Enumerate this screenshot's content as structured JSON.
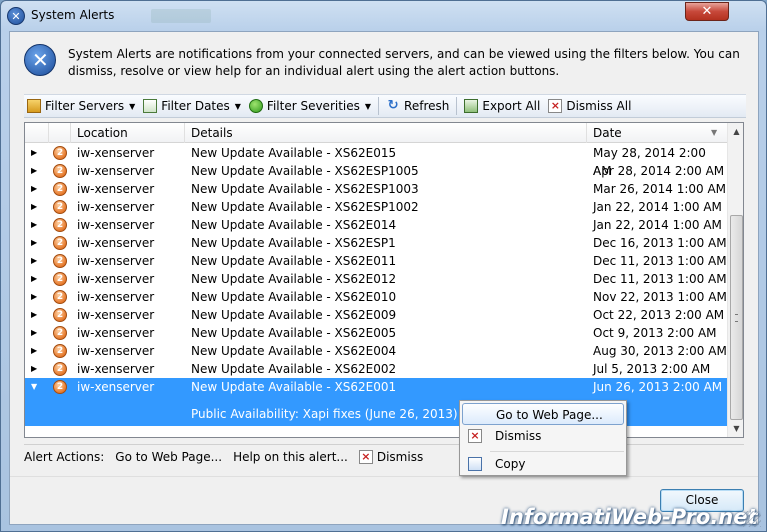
{
  "window": {
    "title": "System Alerts",
    "close_glyph": "✕"
  },
  "info": {
    "text": "System Alerts are notifications from your connected servers, and can be viewed using the filters below. You can dismiss, resolve or view help for an individual alert using the alert action buttons.",
    "icon": "xenserver-icon"
  },
  "toolbar": {
    "filter_servers": "Filter Servers",
    "filter_dates": "Filter Dates",
    "filter_severities": "Filter Severities",
    "refresh": "Refresh",
    "export_all": "Export All",
    "dismiss_all": "Dismiss All"
  },
  "grid": {
    "columns": {
      "location": "Location",
      "details": "Details",
      "date": "Date"
    },
    "rows": [
      {
        "location": "iw-xenserver",
        "details": "New Update Available - XS62E015",
        "date": "May 28, 2014 2:00 AM"
      },
      {
        "location": "iw-xenserver",
        "details": "New Update Available - XS62ESP1005",
        "date": "Apr 28, 2014 2:00 AM"
      },
      {
        "location": "iw-xenserver",
        "details": "New Update Available - XS62ESP1003",
        "date": "Mar 26, 2014 1:00 AM"
      },
      {
        "location": "iw-xenserver",
        "details": "New Update Available - XS62ESP1002",
        "date": "Jan 22, 2014 1:00 AM"
      },
      {
        "location": "iw-xenserver",
        "details": "New Update Available - XS62E014",
        "date": "Jan 22, 2014 1:00 AM"
      },
      {
        "location": "iw-xenserver",
        "details": "New Update Available - XS62ESP1",
        "date": "Dec 16, 2013 1:00 AM"
      },
      {
        "location": "iw-xenserver",
        "details": "New Update Available - XS62E011",
        "date": "Dec 11, 2013 1:00 AM"
      },
      {
        "location": "iw-xenserver",
        "details": "New Update Available - XS62E012",
        "date": "Dec 11, 2013 1:00 AM"
      },
      {
        "location": "iw-xenserver",
        "details": "New Update Available - XS62E010",
        "date": "Nov 22, 2013 1:00 AM"
      },
      {
        "location": "iw-xenserver",
        "details": "New Update Available - XS62E009",
        "date": "Oct 22, 2013 2:00 AM"
      },
      {
        "location": "iw-xenserver",
        "details": "New Update Available - XS62E005",
        "date": "Oct 9, 2013 2:00 AM"
      },
      {
        "location": "iw-xenserver",
        "details": "New Update Available - XS62E004",
        "date": "Aug 30, 2013 2:00 AM"
      },
      {
        "location": "iw-xenserver",
        "details": "New Update Available - XS62E002",
        "date": "Jul 5, 2013 2:00 AM"
      }
    ],
    "selected": {
      "location": "iw-xenserver",
      "details": "New Update Available - XS62E001",
      "date": "Jun 26, 2013 2:00 AM",
      "extra": "Public Availability: Xapi fixes (June 26, 2013)"
    },
    "severity_glyph": "2"
  },
  "context_menu": {
    "go_to_web_page": "Go to Web Page...",
    "dismiss": "Dismiss",
    "copy": "Copy"
  },
  "actions": {
    "label": "Alert Actions:",
    "go_to_web_page": "Go to Web Page...",
    "help": "Help on this alert...",
    "dismiss": "Dismiss"
  },
  "footer": {
    "close": "Close"
  },
  "watermark": "InformatiWeb-Pro.net",
  "colors": {
    "selection": "#3399ff",
    "title_gradient": "#b9d0ea",
    "close_red": "#c7483a"
  }
}
